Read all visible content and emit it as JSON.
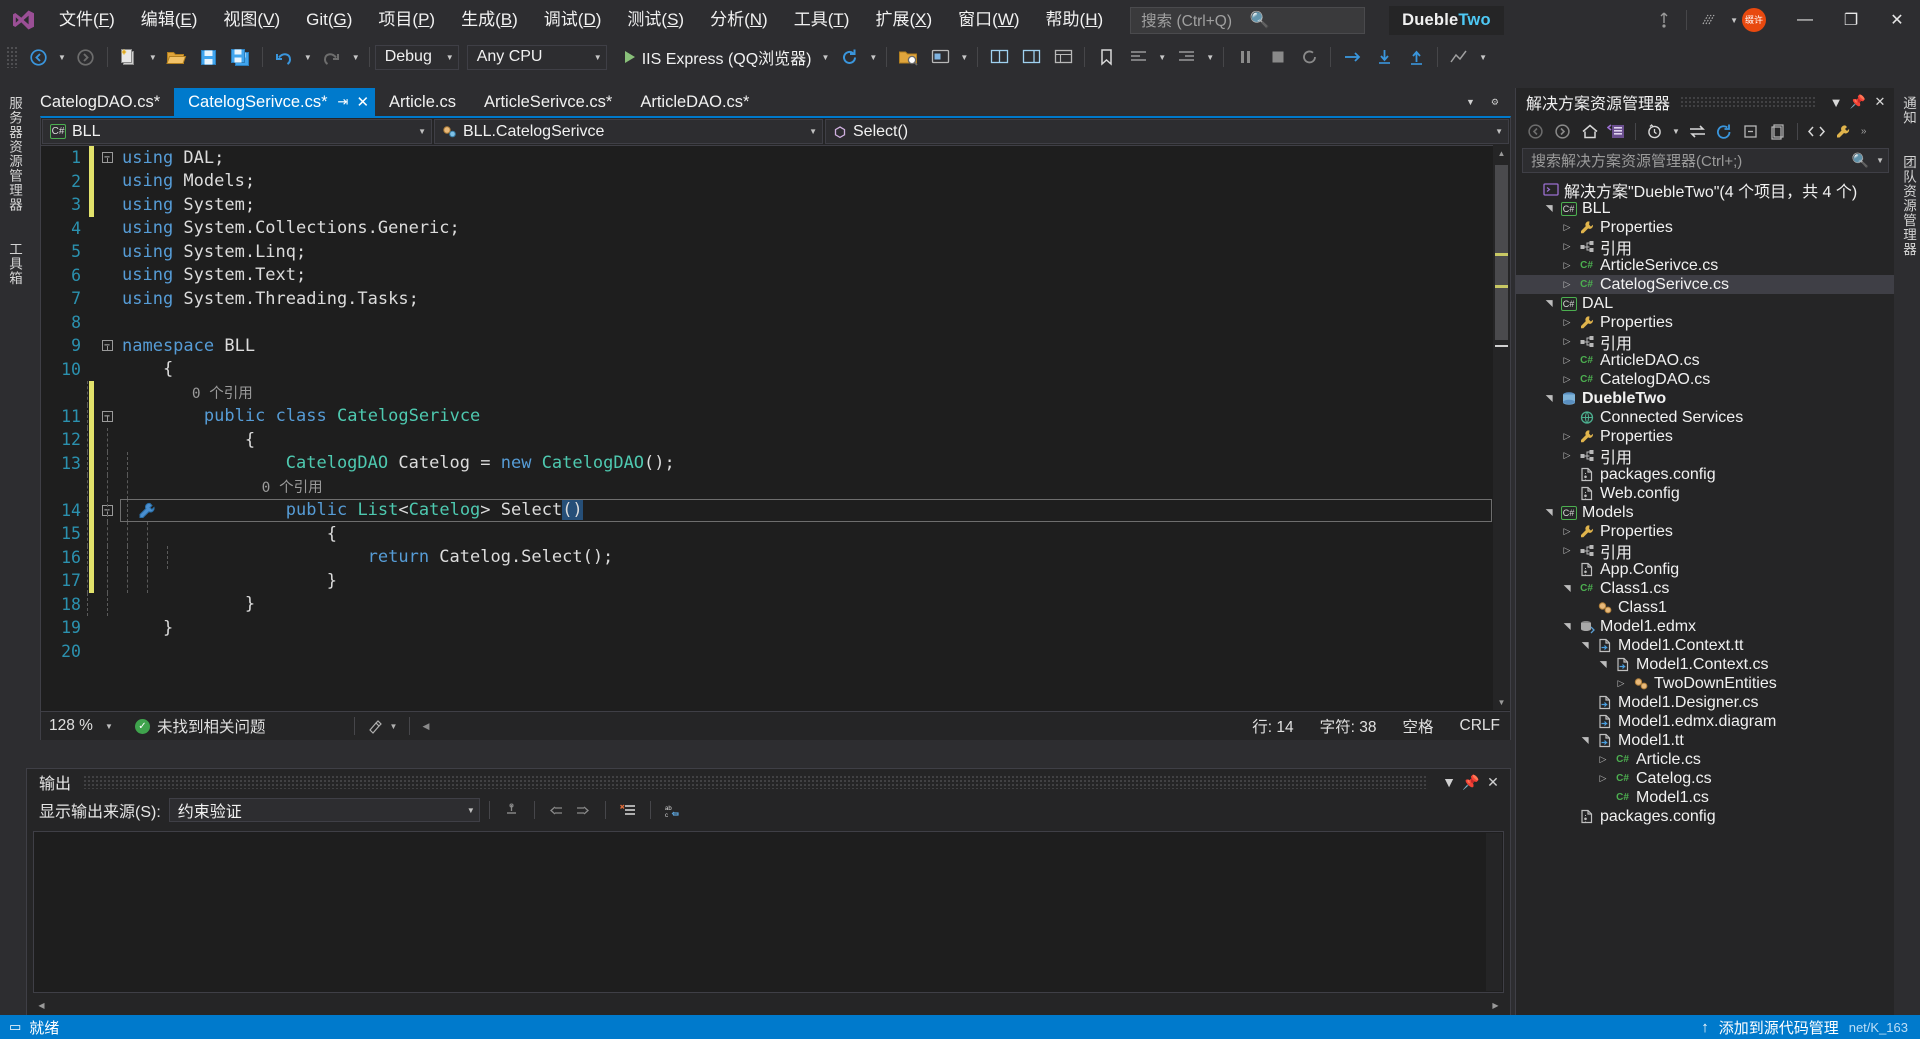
{
  "titlebar": {
    "menus": [
      {
        "label": "文件(F)"
      },
      {
        "label": "编辑(E)"
      },
      {
        "label": "视图(V)"
      },
      {
        "label": "Git(G)"
      },
      {
        "label": "项目(P)"
      },
      {
        "label": "生成(B)"
      },
      {
        "label": "调试(D)"
      },
      {
        "label": "测试(S)"
      },
      {
        "label": "分析(N)"
      },
      {
        "label": "工具(T)"
      },
      {
        "label": "扩展(X)"
      },
      {
        "label": "窗口(W)"
      },
      {
        "label": "帮助(H)"
      }
    ],
    "search_placeholder": "搜索 (Ctrl+Q)",
    "project_name_a": "Dueble",
    "project_name_b": "Two",
    "avatar_text": "缀许",
    "live_share": "Live Share",
    "minimize": "—",
    "restore": "❐",
    "close": "✕"
  },
  "toolbar": {
    "configuration": "Debug",
    "platform": "Any CPU",
    "run_target": "IIS Express (QQ浏览器)"
  },
  "left_rail": {
    "tabs": [
      "服务器资源管理器",
      "工具箱"
    ]
  },
  "right_rail": {
    "tabs": [
      "通知",
      "团队资源管理器"
    ]
  },
  "editor": {
    "tabs": [
      {
        "label": "CatelogDAO.cs*",
        "active": false
      },
      {
        "label": "CatelogSerivce.cs*",
        "active": true
      },
      {
        "label": "Article.cs",
        "active": false
      },
      {
        "label": "ArticleSerivce.cs*",
        "active": false
      },
      {
        "label": "ArticleDAO.cs*",
        "active": false
      }
    ],
    "nav": {
      "project": "BLL",
      "type": "BLL.CatelogSerivce",
      "member": "Select()"
    },
    "lines": [
      {
        "n": "1",
        "change": "y",
        "fold": "minus",
        "text": [
          {
            "t": "using",
            "c": "kw"
          },
          {
            "t": " DAL;",
            "c": "ns"
          }
        ]
      },
      {
        "n": "2",
        "change": "y",
        "fold": "bar",
        "text": [
          {
            "t": "using",
            "c": "kw"
          },
          {
            "t": " Models;",
            "c": "ns"
          }
        ]
      },
      {
        "n": "3",
        "change": "y",
        "fold": "bar",
        "text": [
          {
            "t": "using",
            "c": "kw"
          },
          {
            "t": " System;",
            "c": "ns"
          }
        ]
      },
      {
        "n": "4",
        "change": "",
        "fold": "bar",
        "text": [
          {
            "t": "using",
            "c": "kw"
          },
          {
            "t": " System.Collections.Generic;",
            "c": "ns"
          }
        ]
      },
      {
        "n": "5",
        "change": "",
        "fold": "bar",
        "text": [
          {
            "t": "using",
            "c": "kw"
          },
          {
            "t": " System.Linq;",
            "c": "ns"
          }
        ]
      },
      {
        "n": "6",
        "change": "",
        "fold": "bar",
        "text": [
          {
            "t": "using",
            "c": "kw"
          },
          {
            "t": " System.Text;",
            "c": "ns"
          }
        ]
      },
      {
        "n": "7",
        "change": "",
        "fold": "barend",
        "text": [
          {
            "t": "using",
            "c": "kw"
          },
          {
            "t": " System.Threading.Tasks;",
            "c": "ns"
          }
        ]
      },
      {
        "n": "8",
        "change": "",
        "fold": "",
        "text": []
      },
      {
        "n": "9",
        "change": "",
        "fold": "minus",
        "text": [
          {
            "t": "namespace",
            "c": "kw"
          },
          {
            "t": " BLL",
            "c": "ns"
          }
        ]
      },
      {
        "n": "10",
        "change": "",
        "fold": "bar",
        "text": [
          {
            "t": "{",
            "c": "ns"
          }
        ],
        "indent": 1
      },
      {
        "n": "",
        "change": "y",
        "fold": "bar",
        "hint": "0 个引用",
        "indent": 2
      },
      {
        "n": "11",
        "change": "y",
        "fold": "minus2",
        "text": [
          {
            "t": "public",
            "c": "kw"
          },
          {
            "t": " ",
            "c": "ns"
          },
          {
            "t": "class",
            "c": "kw"
          },
          {
            "t": " ",
            "c": "ns"
          },
          {
            "t": "CatelogSerivce",
            "c": "ty"
          }
        ],
        "indent": 2
      },
      {
        "n": "12",
        "change": "y",
        "fold": "bar2",
        "text": [
          {
            "t": "{",
            "c": "ns"
          }
        ],
        "indent": 3
      },
      {
        "n": "13",
        "change": "y",
        "fold": "bar2",
        "text": [
          {
            "t": "CatelogDAO",
            "c": "ty"
          },
          {
            "t": " Catelog = ",
            "c": "ns"
          },
          {
            "t": "new",
            "c": "kw"
          },
          {
            "t": " ",
            "c": "ns"
          },
          {
            "t": "CatelogDAO",
            "c": "ty"
          },
          {
            "t": "();",
            "c": "ns"
          }
        ],
        "indent": 4
      },
      {
        "n": "",
        "change": "y",
        "fold": "bar2",
        "hint": "0 个引用",
        "indent": 4
      },
      {
        "n": "14",
        "change": "y",
        "fold": "minus3",
        "current": true,
        "wrench": true,
        "text": [
          {
            "t": "public",
            "c": "kw"
          },
          {
            "t": " ",
            "c": "ns"
          },
          {
            "t": "List",
            "c": "ty"
          },
          {
            "t": "<",
            "c": "ns"
          },
          {
            "t": "Catelog",
            "c": "ty"
          },
          {
            "t": "> Select",
            "c": "ns"
          },
          {
            "t": "()",
            "c": "sel"
          }
        ],
        "indent": 4
      },
      {
        "n": "15",
        "change": "y",
        "fold": "bar3",
        "text": [
          {
            "t": "{",
            "c": "ns"
          }
        ],
        "indent": 5
      },
      {
        "n": "16",
        "change": "y",
        "fold": "bar3",
        "text": [
          {
            "t": "return",
            "c": "kw"
          },
          {
            "t": " Catelog.Select();",
            "c": "ns"
          }
        ],
        "indent": 6
      },
      {
        "n": "17",
        "change": "y",
        "fold": "bar3end",
        "text": [
          {
            "t": "}",
            "c": "ns"
          }
        ],
        "indent": 5
      },
      {
        "n": "18",
        "change": "",
        "fold": "bar2end",
        "text": [
          {
            "t": "}",
            "c": "ns"
          }
        ],
        "indent": 3
      },
      {
        "n": "19",
        "change": "",
        "fold": "barend",
        "text": [
          {
            "t": "}",
            "c": "ns"
          }
        ],
        "indent": 1
      },
      {
        "n": "20",
        "change": "",
        "fold": "",
        "text": []
      }
    ],
    "status": {
      "zoom": "128 %",
      "issues": "未找到相关问题",
      "line": "行: 14",
      "col": "字符: 38",
      "spaces": "空格",
      "eol": "CRLF"
    }
  },
  "output": {
    "title": "输出",
    "source_label": "显示输出来源(S):",
    "source_value": "约束验证",
    "body_text": ""
  },
  "solution_explorer": {
    "title": "解决方案资源管理器",
    "search_placeholder": "搜索解决方案资源管理器(Ctrl+;)",
    "tree": [
      {
        "depth": 0,
        "arrow": "",
        "icon": "solution",
        "label": "解决方案\"DuebleTwo\"(4 个项目，共 4 个)",
        "selected": false
      },
      {
        "depth": 1,
        "arrow": "open",
        "icon": "csproj",
        "label": "BLL",
        "selected": false
      },
      {
        "depth": 2,
        "arrow": "closed",
        "icon": "wrench",
        "label": "Properties",
        "selected": false
      },
      {
        "depth": 2,
        "arrow": "closed",
        "icon": "refs",
        "label": "引用",
        "selected": false
      },
      {
        "depth": 2,
        "arrow": "closed",
        "icon": "cs",
        "label": "ArticleSerivce.cs",
        "selected": false
      },
      {
        "depth": 2,
        "arrow": "closed",
        "icon": "cs",
        "label": "CatelogSerivce.cs",
        "selected": true
      },
      {
        "depth": 1,
        "arrow": "open",
        "icon": "csproj",
        "label": "DAL",
        "selected": false
      },
      {
        "depth": 2,
        "arrow": "closed",
        "icon": "wrench",
        "label": "Properties",
        "selected": false
      },
      {
        "depth": 2,
        "arrow": "closed",
        "icon": "refs",
        "label": "引用",
        "selected": false
      },
      {
        "depth": 2,
        "arrow": "closed",
        "icon": "cs",
        "label": "ArticleDAO.cs",
        "selected": false
      },
      {
        "depth": 2,
        "arrow": "closed",
        "icon": "cs",
        "label": "CatelogDAO.cs",
        "selected": false
      },
      {
        "depth": 1,
        "arrow": "open",
        "icon": "webproj",
        "label": "DuebleTwo",
        "selected": false,
        "bold": true
      },
      {
        "depth": 2,
        "arrow": "",
        "icon": "connected",
        "label": "Connected Services",
        "selected": false
      },
      {
        "depth": 2,
        "arrow": "closed",
        "icon": "wrench",
        "label": "Properties",
        "selected": false
      },
      {
        "depth": 2,
        "arrow": "closed",
        "icon": "refs",
        "label": "引用",
        "selected": false
      },
      {
        "depth": 2,
        "arrow": "",
        "icon": "config",
        "label": "packages.config",
        "selected": false
      },
      {
        "depth": 2,
        "arrow": "",
        "icon": "config",
        "label": "Web.config",
        "selected": false
      },
      {
        "depth": 1,
        "arrow": "open",
        "icon": "csproj",
        "label": "Models",
        "selected": false
      },
      {
        "depth": 2,
        "arrow": "closed",
        "icon": "wrench",
        "label": "Properties",
        "selected": false
      },
      {
        "depth": 2,
        "arrow": "closed",
        "icon": "refs",
        "label": "引用",
        "selected": false
      },
      {
        "depth": 2,
        "arrow": "",
        "icon": "config",
        "label": "App.Config",
        "selected": false
      },
      {
        "depth": 2,
        "arrow": "open",
        "icon": "cs",
        "label": "Class1.cs",
        "selected": false
      },
      {
        "depth": 3,
        "arrow": "",
        "icon": "class",
        "label": "Class1",
        "selected": false
      },
      {
        "depth": 2,
        "arrow": "open",
        "icon": "edmx",
        "label": "Model1.edmx",
        "selected": false
      },
      {
        "depth": 3,
        "arrow": "open",
        "icon": "tt",
        "label": "Model1.Context.tt",
        "selected": false
      },
      {
        "depth": 4,
        "arrow": "open",
        "icon": "tt",
        "label": "Model1.Context.cs",
        "selected": false
      },
      {
        "depth": 5,
        "arrow": "closed",
        "icon": "class",
        "label": "TwoDownEntities",
        "selected": false
      },
      {
        "depth": 3,
        "arrow": "",
        "icon": "tt",
        "label": "Model1.Designer.cs",
        "selected": false
      },
      {
        "depth": 3,
        "arrow": "",
        "icon": "tt",
        "label": "Model1.edmx.diagram",
        "selected": false
      },
      {
        "depth": 3,
        "arrow": "open",
        "icon": "tt",
        "label": "Model1.tt",
        "selected": false
      },
      {
        "depth": 4,
        "arrow": "closed",
        "icon": "cs",
        "label": "Article.cs",
        "selected": false
      },
      {
        "depth": 4,
        "arrow": "closed",
        "icon": "cs",
        "label": "Catelog.cs",
        "selected": false
      },
      {
        "depth": 4,
        "arrow": "",
        "icon": "cs",
        "label": "Model1.cs",
        "selected": false
      },
      {
        "depth": 2,
        "arrow": "",
        "icon": "config",
        "label": "packages.config",
        "selected": false
      }
    ]
  },
  "statusbar": {
    "ready": "就绪",
    "add_to_source": "添加到源代码管理",
    "watermark": "net/K_163"
  }
}
